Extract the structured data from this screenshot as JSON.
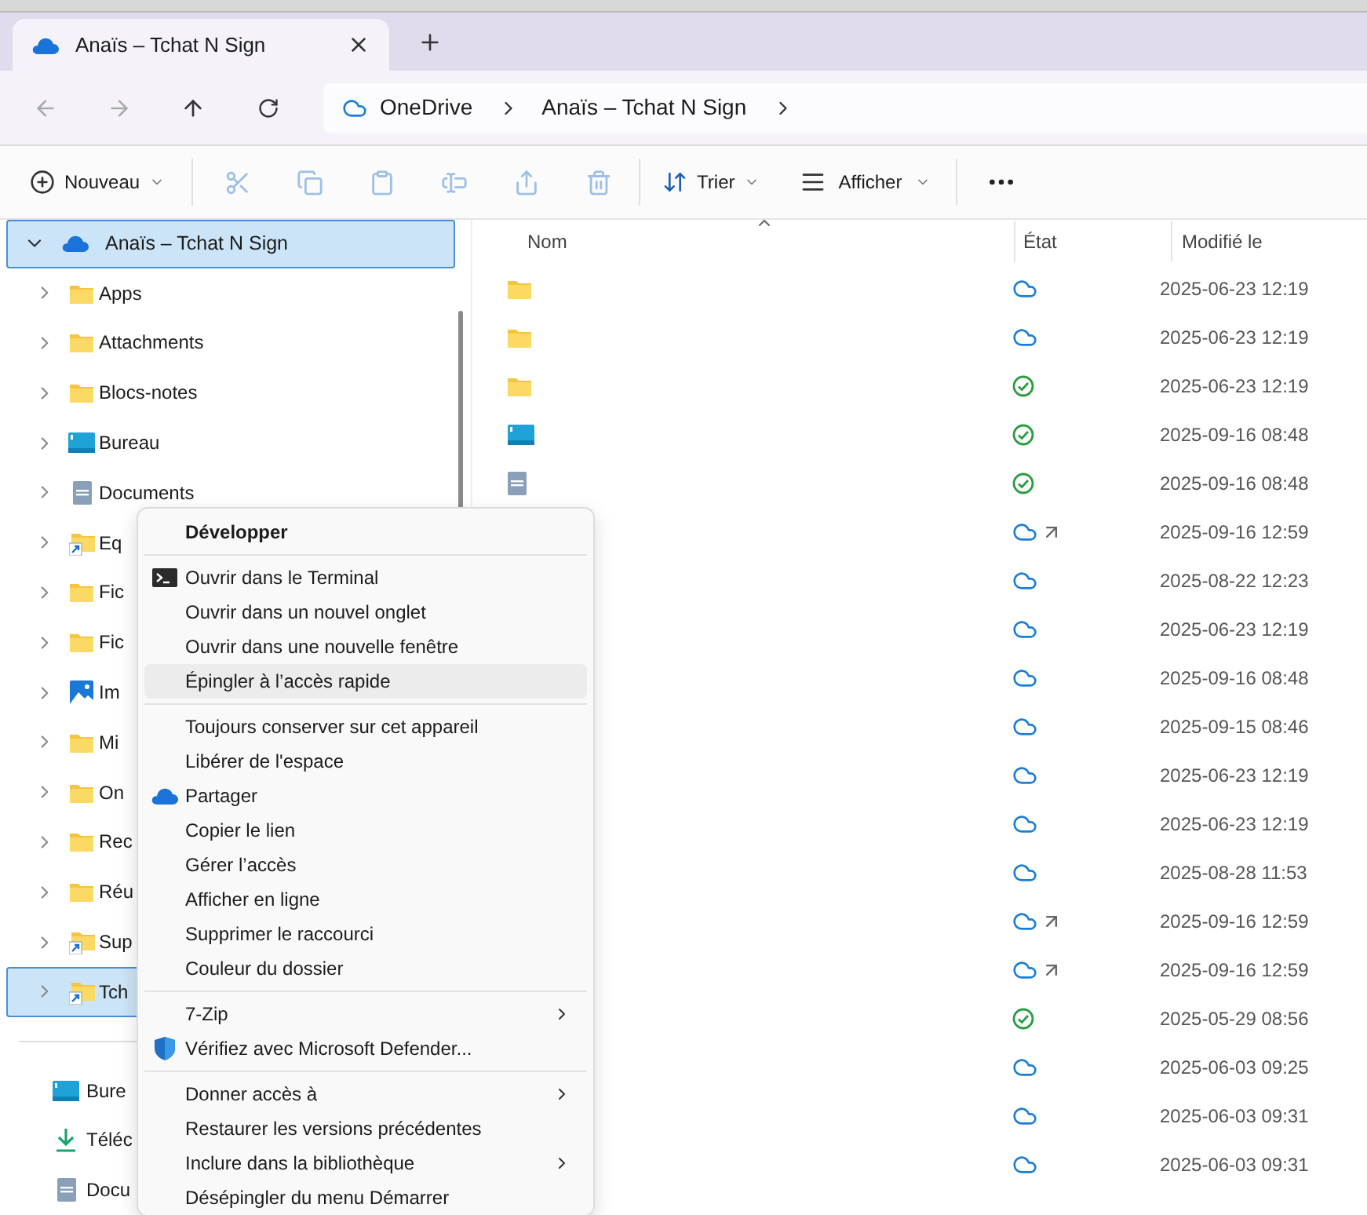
{
  "tabs": [
    {
      "title": "Anaïs – Tchat N Sign",
      "selected": true
    }
  ],
  "breadcrumb": [
    "OneDrive",
    "Anaïs – Tchat N Sign"
  ],
  "toolbar": {
    "new_label": "Nouveau",
    "actions": [
      {
        "kind": "cut",
        "disabled": true
      },
      {
        "kind": "copy",
        "disabled": true
      },
      {
        "kind": "paste",
        "disabled": true
      },
      {
        "kind": "rename",
        "disabled": true
      },
      {
        "kind": "share",
        "disabled": true
      },
      {
        "kind": "delete",
        "disabled": true
      }
    ],
    "sort_label": "Trier",
    "view_label": "Afficher"
  },
  "sidebar": {
    "root": {
      "label": "Anaïs – Tchat N Sign",
      "expanded": true,
      "selected": true,
      "children": [
        {
          "label": "Apps",
          "kind": "folder",
          "selected": false
        },
        {
          "label": "Attachments",
          "kind": "folder",
          "selected": false
        },
        {
          "label": "Blocs-notes",
          "kind": "folder",
          "selected": false
        },
        {
          "label": "Bureau",
          "kind": "desktop",
          "selected": false
        },
        {
          "label": "Documents",
          "kind": "document",
          "selected": false
        },
        {
          "label": "Eq",
          "kind": "shortcut",
          "selected": false
        },
        {
          "label": "Fic",
          "kind": "folder",
          "selected": false
        },
        {
          "label": "Fic",
          "kind": "folder",
          "selected": false
        },
        {
          "label": "Im",
          "kind": "pictures",
          "selected": false
        },
        {
          "label": "Mi",
          "kind": "folder",
          "selected": false
        },
        {
          "label": "On",
          "kind": "folder",
          "selected": false
        },
        {
          "label": "Rec",
          "kind": "folder",
          "selected": false
        },
        {
          "label": "Réu",
          "kind": "folder",
          "selected": false
        },
        {
          "label": "Sup",
          "kind": "shortcut",
          "selected": false
        },
        {
          "label": "Tch",
          "kind": "shortcut",
          "selected": true
        }
      ]
    },
    "quick_access": [
      {
        "label": "Bure",
        "kind": "desktop"
      },
      {
        "label": "Téléc",
        "kind": "download"
      },
      {
        "label": "Docu",
        "kind": "document"
      }
    ]
  },
  "table": {
    "columns": [
      "Nom",
      "État",
      "Modifié le"
    ],
    "rows": [
      {
        "kind": "folder",
        "status": {
          "kind": "cloud"
        },
        "modified": "2025-06-23 12:19"
      },
      {
        "kind": "folder",
        "status": {
          "kind": "cloud"
        },
        "modified": "2025-06-23 12:19"
      },
      {
        "kind": "folder",
        "status": {
          "kind": "synced"
        },
        "modified": "2025-06-23 12:19"
      },
      {
        "kind": "desktop",
        "status": {
          "kind": "synced"
        },
        "modified": "2025-09-16 08:48"
      },
      {
        "kind": "document",
        "status": {
          "kind": "synced"
        },
        "modified": "2025-09-16 08:48"
      },
      {
        "status": {
          "kind": "cloud-shortcut"
        },
        "modified": "2025-09-16 12:59"
      },
      {
        "status": {
          "kind": "cloud"
        },
        "modified": "2025-08-22 12:23"
      },
      {
        "status": {
          "kind": "cloud"
        },
        "modified": "2025-06-23 12:19"
      },
      {
        "status": {
          "kind": "cloud"
        },
        "modified": "2025-09-16 08:48"
      },
      {
        "status": {
          "kind": "cloud"
        },
        "modified": "2025-09-15 08:46"
      },
      {
        "status": {
          "kind": "cloud"
        },
        "modified": "2025-06-23 12:19"
      },
      {
        "status": {
          "kind": "cloud"
        },
        "modified": "2025-06-23 12:19"
      },
      {
        "status": {
          "kind": "cloud"
        },
        "modified": "2025-08-28 11:53"
      },
      {
        "status": {
          "kind": "cloud-shortcut"
        },
        "modified": "2025-09-16 12:59"
      },
      {
        "status": {
          "kind": "cloud-shortcut"
        },
        "modified": "2025-09-16 12:59"
      },
      {
        "status": {
          "kind": "synced"
        },
        "modified": "2025-05-29 08:56"
      },
      {
        "status": {
          "kind": "cloud"
        },
        "modified": "2025-06-03 09:25"
      },
      {
        "status": {
          "kind": "cloud"
        },
        "modified": "2025-06-03 09:31"
      },
      {
        "status": {
          "kind": "cloud"
        },
        "modified": "2025-06-03 09:31"
      }
    ]
  },
  "context_menu": {
    "groups": [
      [
        {
          "label": "Développer",
          "kind": "default",
          "highlighted": false,
          "submenu": false
        }
      ],
      [
        {
          "label": "Ouvrir dans le Terminal",
          "kind": "terminal",
          "highlighted": false,
          "submenu": false
        },
        {
          "label": "Ouvrir dans un nouvel onglet",
          "kind": "plain",
          "highlighted": false,
          "submenu": false
        },
        {
          "label": "Ouvrir dans une nouvelle fenêtre",
          "kind": "plain",
          "highlighted": false,
          "submenu": false
        },
        {
          "label": "Épingler à l’accès rapide",
          "kind": "plain",
          "highlighted": true,
          "submenu": false
        }
      ],
      [
        {
          "label": "Toujours conserver sur cet appareil",
          "kind": "plain",
          "highlighted": false,
          "submenu": false
        },
        {
          "label": "Libérer de l'espace",
          "kind": "plain",
          "highlighted": false,
          "submenu": false
        },
        {
          "label": "Partager",
          "kind": "cloud",
          "highlighted": false,
          "submenu": false
        },
        {
          "label": "Copier le lien",
          "kind": "plain",
          "highlighted": false,
          "submenu": false
        },
        {
          "label": "Gérer l’accès",
          "kind": "plain",
          "highlighted": false,
          "submenu": false
        },
        {
          "label": "Afficher en ligne",
          "kind": "plain",
          "highlighted": false,
          "submenu": false
        },
        {
          "label": "Supprimer le raccourci",
          "kind": "plain",
          "highlighted": false,
          "submenu": false
        },
        {
          "label": "Couleur du dossier",
          "kind": "plain",
          "highlighted": false,
          "submenu": false
        }
      ],
      [
        {
          "label": "7-Zip",
          "kind": "plain",
          "highlighted": false,
          "submenu": true
        },
        {
          "label": "Vérifiez avec Microsoft Defender...",
          "kind": "shield",
          "highlighted": false,
          "submenu": false
        }
      ],
      [
        {
          "label": "Donner accès à",
          "kind": "plain",
          "highlighted": false,
          "submenu": true
        },
        {
          "label": "Restaurer les versions précédentes",
          "kind": "plain",
          "highlighted": false,
          "submenu": false
        },
        {
          "label": "Inclure dans la bibliothèque",
          "kind": "plain",
          "highlighted": false,
          "submenu": true
        },
        {
          "label": "Désépingler du menu Démarrer",
          "kind": "plain",
          "highlighted": false,
          "submenu": false
        }
      ]
    ]
  }
}
